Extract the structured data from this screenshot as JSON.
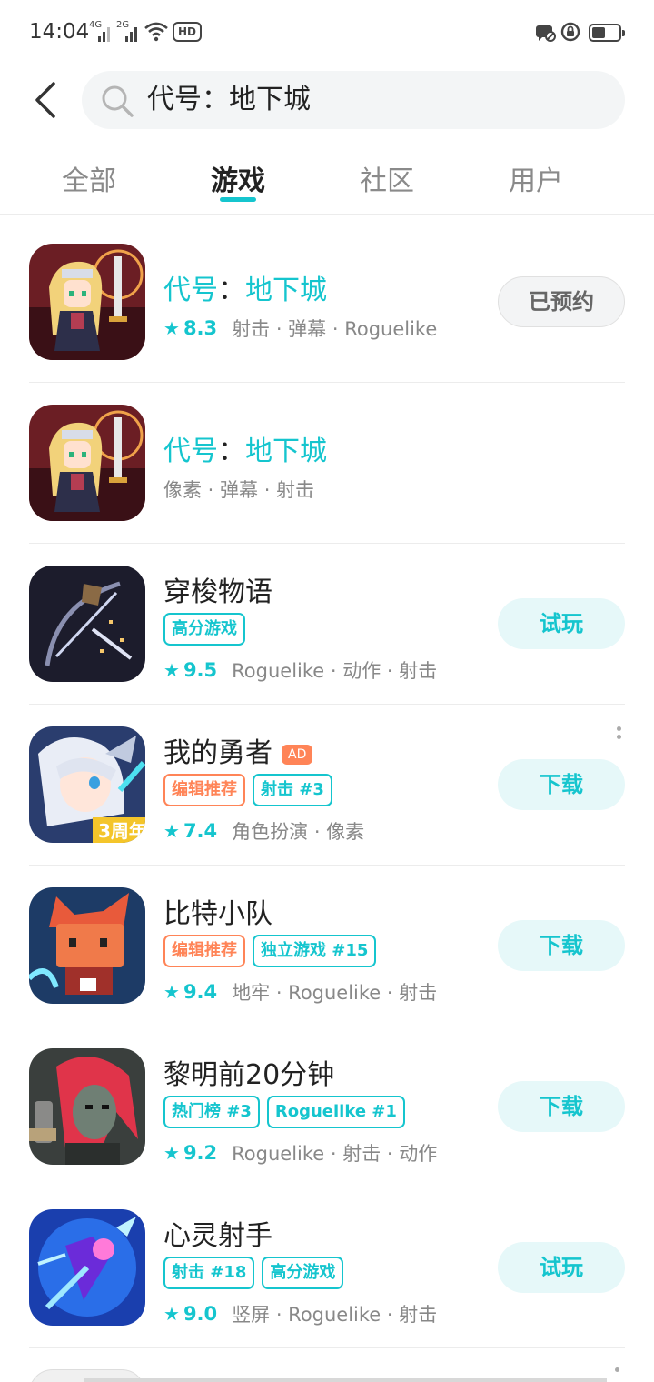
{
  "status_bar": {
    "time": "14:04",
    "net1": "4G",
    "net2": "2G",
    "hd": "HD"
  },
  "search": {
    "value": "代号：地下城"
  },
  "tabs": [
    {
      "label": "全部"
    },
    {
      "label": "游戏"
    },
    {
      "label": "社区"
    },
    {
      "label": "用户"
    }
  ],
  "active_tab": "游戏",
  "accent_color": "#15c5ce",
  "tag_orange_color": "#ff8457",
  "games": [
    {
      "title_a": "代号",
      "title_colon": "：",
      "title_b": "地下城",
      "rating": "8.3",
      "genres": "射击 · 弹幕 · Roguelike",
      "button": "已预约"
    },
    {
      "title_a": "代号",
      "title_colon": "：",
      "title_b": "地下城",
      "genres": "像素 · 弹幕 · 射击"
    },
    {
      "title": "穿梭物语",
      "tags": [
        "高分游戏"
      ],
      "rating": "9.5",
      "genres": "Roguelike · 动作 · 射击",
      "button": "试玩"
    },
    {
      "title": "我的勇者",
      "ad": "AD",
      "tags": [
        "编辑推荐",
        "射击 #3"
      ],
      "rating": "7.4",
      "genres": "角色扮演 · 像素",
      "button": "下载"
    },
    {
      "title": "比特小队",
      "tags": [
        "编辑推荐",
        "独立游戏 #15"
      ],
      "rating": "9.4",
      "genres": "地牢 · Roguelike · 射击",
      "button": "下载"
    },
    {
      "title": "黎明前20分钟",
      "tags": [
        "热门榜 #3",
        "Roguelike #1"
      ],
      "rating": "9.2",
      "genres": "Roguelike · 射击 · 动作",
      "button": "下载"
    },
    {
      "title": "心灵射手",
      "tags": [
        "射击 #18",
        "高分游戏"
      ],
      "rating": "9.0",
      "genres": "竖屏 · Roguelike · 射击",
      "button": "试玩"
    }
  ]
}
